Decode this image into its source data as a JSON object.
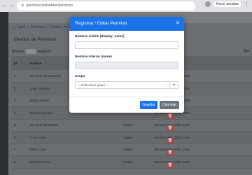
{
  "browser": {
    "url": "permisos.test/admin/permisos",
    "guest_label": "Hacer anuales"
  },
  "breadcrumb": {
    "items": [
      "Inicio",
      "/",
      "Permisos",
      "/",
      "Gestión de Permisos"
    ]
  },
  "page": {
    "title": "Gestión de Permisos",
    "show_label": "Mostrar",
    "entries_label": "registros",
    "search_label": "Bus"
  },
  "table": {
    "headers": [
      "ID",
      "Nombre",
      "",
      "",
      ""
    ],
    "rows": [
      {
        "id": "1",
        "name": "Ver Panel de Usuarios",
        "group": "",
        "date": "28 noviembre 2025 13:54"
      },
      {
        "id": "2",
        "name": "Crear Usuario",
        "group": "",
        "date": "28 noviembre 2025 13:54"
      },
      {
        "id": "3",
        "name": "Editar Usuario",
        "group": "",
        "date": "28 noviembre 2025 13:54"
      },
      {
        "id": "4",
        "name": "Eliminar Usuario",
        "group": "",
        "date": "28 noviembre 2025 13:54"
      },
      {
        "id": "5",
        "name": "Ver Panel de Cartas",
        "group": "Cartas",
        "date": "28 noviembre 2025 13:54"
      },
      {
        "id": "6",
        "name": "Crear Carta",
        "group": "Cartas",
        "date": "28 noviembre 2025 13:54"
      },
      {
        "id": "7",
        "name": "Editar Carta",
        "group": "Cartas",
        "date": "28 noviembre 2025 13:54"
      },
      {
        "id": "8",
        "name": "Eliminar Carta",
        "group": "Cartas",
        "date": "28 noviembre 2025 13:54"
      }
    ]
  },
  "modal": {
    "title": "Registrar / Editar Permiso",
    "display_name_label": "Nombre visible (display_name)",
    "display_name_value": "",
    "internal_name_label": "Nombre interno (name)",
    "internal_name_value": "",
    "group_label": "Grupo",
    "group_placeholder": "-- Seleccione grupo --",
    "save_label": "Guardar",
    "cancel_label": "Cancelar"
  },
  "colors": {
    "primary": "#1a73e8",
    "secondary": "#6c757d",
    "danger": "#a54a4a"
  }
}
